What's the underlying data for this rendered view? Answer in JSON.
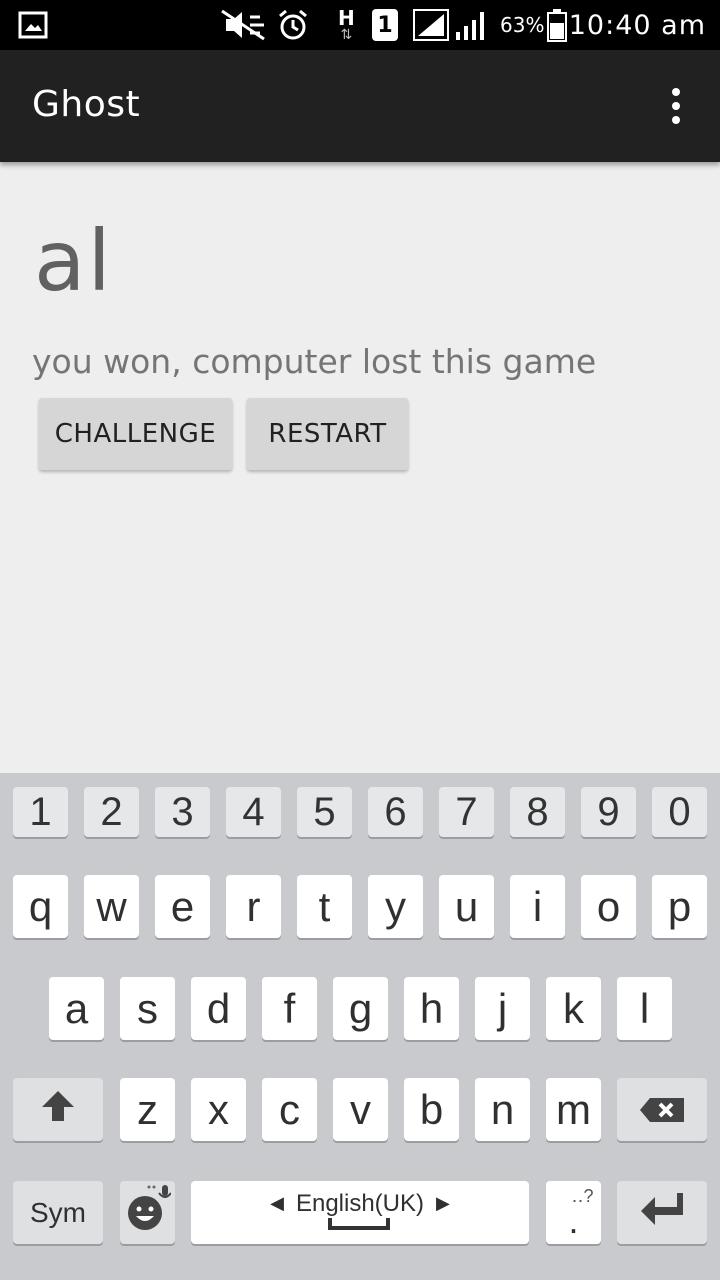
{
  "status_bar": {
    "icons": [
      "gallery-icon",
      "mute-icon",
      "alarm-icon",
      "hspa-data-icon",
      "sim1-icon",
      "signal-icon",
      "signal-icon-2",
      "battery-icon"
    ],
    "network_letter": "H",
    "sim_number": "1",
    "battery_percent": "63%",
    "time": "10:40 am"
  },
  "app_bar": {
    "title": "Ghost",
    "menu_icon": "overflow-menu-icon"
  },
  "game": {
    "word": "al",
    "message": "you won, computer lost this game",
    "challenge_label": "CHALLENGE",
    "restart_label": "RESTART"
  },
  "keyboard": {
    "number_row": [
      "1",
      "2",
      "3",
      "4",
      "5",
      "6",
      "7",
      "8",
      "9",
      "0"
    ],
    "row1": [
      "q",
      "w",
      "e",
      "r",
      "t",
      "y",
      "u",
      "i",
      "o",
      "p"
    ],
    "row2": [
      "a",
      "s",
      "d",
      "f",
      "g",
      "h",
      "j",
      "k",
      "l"
    ],
    "row3": [
      "z",
      "x",
      "c",
      "v",
      "b",
      "n",
      "m"
    ],
    "sym_label": "Sym",
    "language_label": "English(UK)",
    "shift_icon": "shift-icon",
    "backspace_icon": "backspace-icon",
    "emoji_icon": "emoji-mic-icon",
    "enter_icon": "enter-icon",
    "period_key": ".",
    "period_hint": "‥?"
  }
}
